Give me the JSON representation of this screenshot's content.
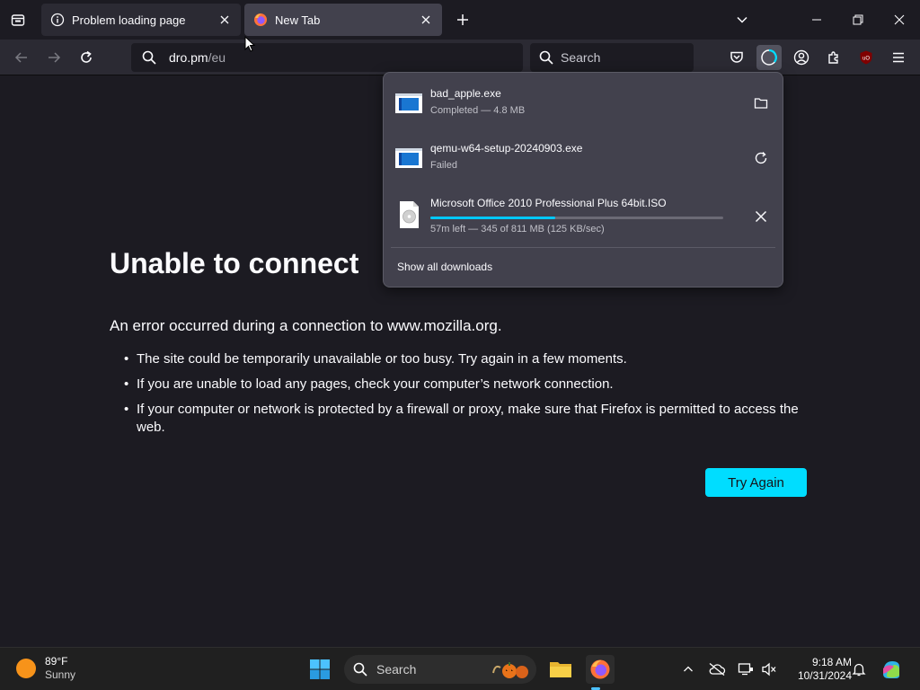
{
  "tabs": [
    {
      "title": "Problem loading page",
      "icon": "info-icon",
      "active": true
    },
    {
      "title": "New Tab",
      "icon": "firefox-icon",
      "active": false
    }
  ],
  "navbar": {
    "url_host": "dro.pm",
    "url_path": "/eu",
    "search_placeholder": "Search"
  },
  "error_page": {
    "title": "Unable to connect",
    "description": "An error occurred during a connection to www.mozilla.org.",
    "bullets": [
      "The site could be temporarily unavailable or too busy. Try again in a few moments.",
      "If you are unable to load any pages, check your computer’s network connection.",
      "If your computer or network is protected by a firewall or proxy, make sure that Firefox is permitted to access the web."
    ],
    "try_again_label": "Try Again"
  },
  "downloads": {
    "items": [
      {
        "name": "bad_apple.exe",
        "status": "Completed — 4.8 MB",
        "action": "folder-icon"
      },
      {
        "name": "qemu-w64-setup-20240903.exe",
        "status": "Failed",
        "action": "retry-icon"
      },
      {
        "name": "Microsoft Office 2010 Professional Plus 64bit.ISO",
        "status": "57m left — 345 of 811 MB (125 KB/sec)",
        "action": "cancel-icon",
        "progress_percent": 42.5
      }
    ],
    "show_all_label": "Show all downloads"
  },
  "taskbar": {
    "weather_temp": "89°F",
    "weather_condition": "Sunny",
    "search_placeholder": "Search",
    "time": "9:18 AM",
    "date": "10/31/2024"
  },
  "colors": {
    "accent": "#00ddff",
    "progress": "#00c8ff",
    "page_bg": "#1c1b22",
    "toolbar_bg": "#2b2a33",
    "panel_bg": "#42414d"
  }
}
